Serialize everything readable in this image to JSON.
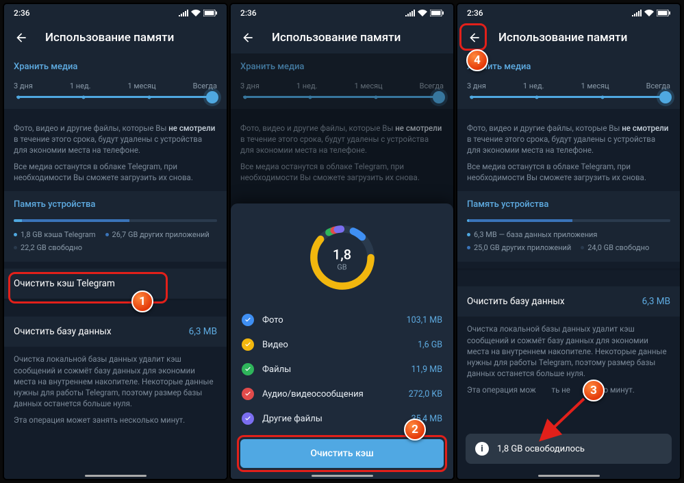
{
  "status": {
    "time": "2:36"
  },
  "header": {
    "title": "Использование памяти"
  },
  "keepMedia": {
    "header": "Хранить медиа",
    "opts": [
      "3 дня",
      "1 нед.",
      "1 месяц",
      "Всегда"
    ],
    "desc1a": "Фото, видео и другие файлы, которые Вы ",
    "desc1b": "не смотрели",
    "desc1c": " в течение этого срока, будут удалены с устройства для экономии места на телефоне.",
    "desc2": "Все медиа останутся в облаке Telegram, при необходимости Вы сможете загрузить их снова."
  },
  "deviceStorage": {
    "header": "Память устройства"
  },
  "s1": {
    "legend": {
      "a": "1,8 GB кэша Telegram",
      "b": "26,7 GB других приложений",
      "c": "22,2 GB свободно"
    },
    "clearCache": "Очистить кэш Telegram",
    "clearDb": "Очистить базу данных",
    "dbSize": "6,3 MB",
    "dbDesc": "Очистка локальной базы данных удалит кэш сообщений и сожмёт базу данных для экономии места на внутреннем накопителе. Некоторые данные нужны для работы Telegram, поэтому размер базы данных останется больше нуля.",
    "dbDesc2": "Эта операция может занять несколько минут."
  },
  "s2": {
    "total": {
      "value": "1,8",
      "unit": "GB"
    },
    "cats": [
      {
        "name": "Фото",
        "size": "103,1 MB",
        "color": "#3f8ff3"
      },
      {
        "name": "Видео",
        "size": "1,6 GB",
        "color": "#f2b70e"
      },
      {
        "name": "Файлы",
        "size": "11,9 MB",
        "color": "#2fb55b"
      },
      {
        "name": "Аудио/видеосообщения",
        "size": "272,0 KB",
        "color": "#e24b4b"
      },
      {
        "name": "Другие файлы",
        "size": "35,4 MB",
        "color": "#7b6ef0"
      }
    ],
    "button": "Очистить кэш"
  },
  "s3": {
    "legend": {
      "a": "6,3 MB — база данных приложения",
      "b": "25,0 GB других приложений",
      "c": "24,0 GB свободно"
    },
    "clearDb": "Очистить базу данных",
    "dbSize": "6,3 MB",
    "dbDesc": "Очистка локальной базы данных удалит кэш сообщений и сожмёт базу данных для экономии места на внутреннем накопителе. Некоторые данные нужны для работы Telegram, поэтому размер базы данных останется больше нуля.",
    "dbDesc2a": "Эта операция мож",
    "dbDesc2b": "ть не",
    "dbDesc2c": "колько минут.",
    "toast": "1,8 GB освободилось"
  },
  "anno": {
    "n1": "1",
    "n2": "2",
    "n3": "3",
    "n4": "4"
  }
}
